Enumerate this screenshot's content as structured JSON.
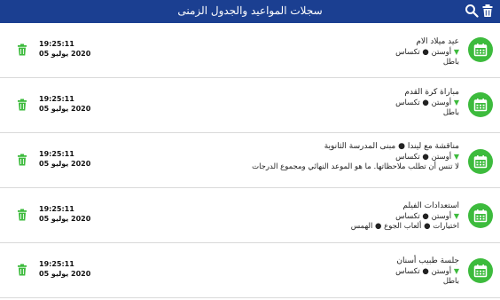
{
  "header": {
    "title": "سجلات المواعيد والجدول الزمنى",
    "search_icon": "search-icon",
    "trash_icon": "trash-icon"
  },
  "colors": {
    "bar": "#1b3f91",
    "accent": "#3dbb3d"
  },
  "records": [
    {
      "title": "عيد ميلاد الام",
      "location": "أوستن ● تكساس",
      "note": "باطل",
      "time": "19:25:11",
      "date": "2020 يوليو 05"
    },
    {
      "title": "مباراة كرة القدم",
      "location": "أوستن ● تكساس",
      "note": "باطل",
      "time": "19:25:11",
      "date": "2020 يوليو 05"
    },
    {
      "title": "مناقشة مع ليندا ● مبنى المدرسة الثانوية",
      "location": "أوستن ● تكساس",
      "note": "لا تنس أن تطلب ملاحظاتها. ما هو الموعد النهائي ومجموع الدرجات",
      "time": "19:25:11",
      "date": "2020 يوليو 05"
    },
    {
      "title": "استعدادات الفيلم",
      "location": "أوستن ● تكساس",
      "note": "اختيارات ● ألعاب الجوع ● الهمس",
      "time": "19:25:11",
      "date": "2020 يوليو 05"
    },
    {
      "title": "جلسة طبيب أسنان",
      "location": "أوستن ● تكساس",
      "note": "باطل",
      "time": "19:25:11",
      "date": "2020 يوليو 05"
    }
  ]
}
